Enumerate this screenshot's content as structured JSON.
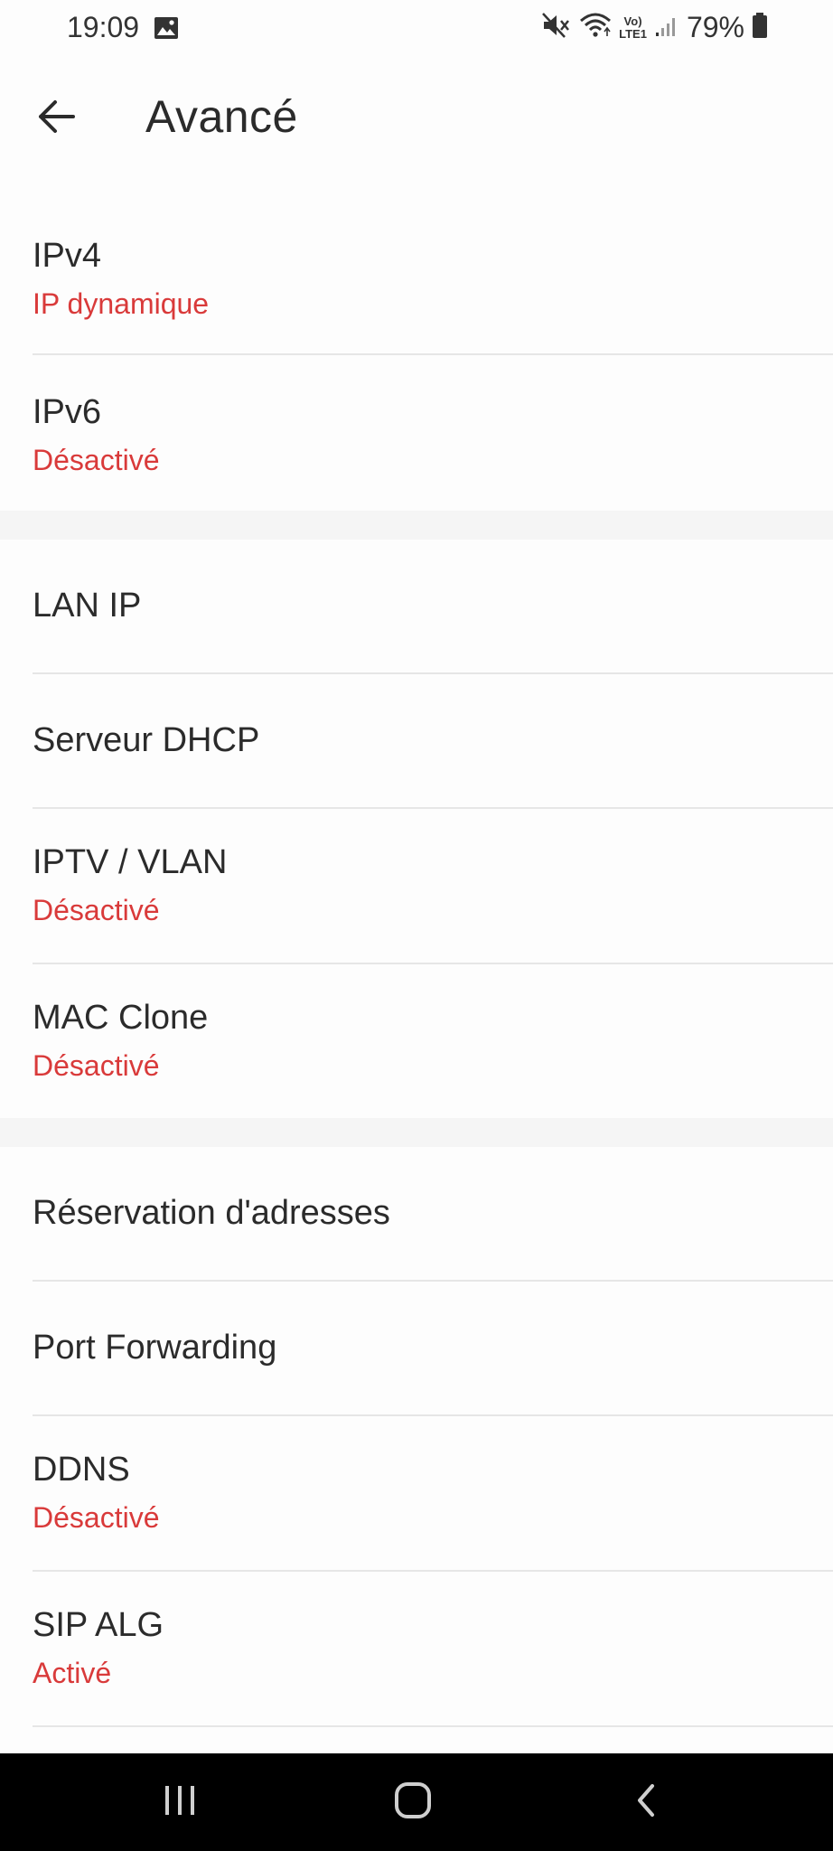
{
  "status_bar": {
    "time": "19:09",
    "battery_percent": "79%",
    "icons": [
      "gallery-icon",
      "mute-icon",
      "wifi-icon",
      "volte-icon",
      "signal-icon",
      "battery-icon"
    ],
    "volte_label_top": "Vo)",
    "volte_label_bottom": "LTE1"
  },
  "header": {
    "title": "Avancé",
    "back_icon": "arrow-left-icon"
  },
  "colors": {
    "accent": "#d93a3a",
    "text": "#2b2b2b",
    "background": "#fdfdfd",
    "section_gap": "#f5f5f5",
    "nav_bar": "#000000"
  },
  "groups": [
    {
      "items": [
        {
          "title": "IPv4",
          "subtitle": "IP dynamique"
        },
        {
          "title": "IPv6",
          "subtitle": "Désactivé"
        }
      ]
    },
    {
      "items": [
        {
          "title": "LAN IP"
        },
        {
          "title": "Serveur DHCP"
        },
        {
          "title": "IPTV / VLAN",
          "subtitle": "Désactivé"
        },
        {
          "title": "MAC Clone",
          "subtitle": "Désactivé"
        }
      ]
    },
    {
      "items": [
        {
          "title": "Réservation d'adresses"
        },
        {
          "title": "Port Forwarding"
        },
        {
          "title": "DDNS",
          "subtitle": "Désactivé"
        },
        {
          "title": "SIP ALG",
          "subtitle": "Activé"
        }
      ]
    }
  ],
  "nav_bar": {
    "icons": [
      "recent-apps-icon",
      "home-icon",
      "back-icon"
    ]
  }
}
